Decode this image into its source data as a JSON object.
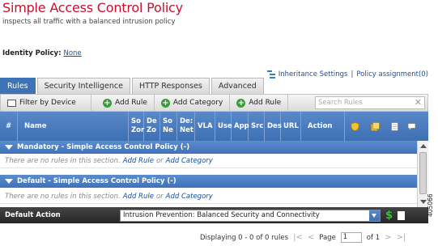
{
  "page": {
    "title": "Simple Access Control Policy",
    "subtitle": "inspects all traffic with a balanced intrusion policy",
    "identity_label": "Identity Policy:",
    "identity_value": "None"
  },
  "links": {
    "inheritance": "Inheritance Settings",
    "separator": "|",
    "policy_assignment": "Policy assignment(0)"
  },
  "tabs": [
    {
      "label": "Rules",
      "active": true
    },
    {
      "label": "Security Intelligence",
      "active": false
    },
    {
      "label": "HTTP Responses",
      "active": false
    },
    {
      "label": "Advanced",
      "active": false
    }
  ],
  "toolbar": {
    "filter": "Filter by Device",
    "add_rule": "Add Rule",
    "add_category": "Add Category",
    "add_rule_2": "Add Rule",
    "search_placeholder": "Search Rules",
    "clear": "✕"
  },
  "columns": {
    "num": "#",
    "name": "Name",
    "src_zones": [
      "So",
      "Zor"
    ],
    "dest_zones": [
      "De",
      "Zo"
    ],
    "src_net": [
      "So",
      "Ne"
    ],
    "dest_net": [
      "De:",
      "Net"
    ],
    "vlan": "VLA",
    "users": "Use",
    "apps": "App",
    "src": "Src",
    "dest": "Des",
    "url": "URL",
    "action": "Action"
  },
  "sections": [
    {
      "label": "Mandatory - Simple Access Control Policy (-)",
      "empty_prefix": "There are no rules in this section.",
      "add_rule": "Add Rule",
      "or": "or",
      "add_category": "Add Category"
    },
    {
      "label": "Default - Simple Access Control Policy (-)",
      "empty_prefix": "There are no rules in this section.",
      "add_rule": "Add Rule",
      "or": "or",
      "add_category": "Add Category"
    }
  ],
  "default_action": {
    "label": "Default Action",
    "value": "Intrusion Prevention: Balanced Security and Connectivity",
    "dollar": "$"
  },
  "pager": {
    "displaying": "Displaying 0 - 0 of 0 rules",
    "page_label": "Page",
    "page_value": "1",
    "of": "of 1"
  },
  "figure_id": "405066"
}
